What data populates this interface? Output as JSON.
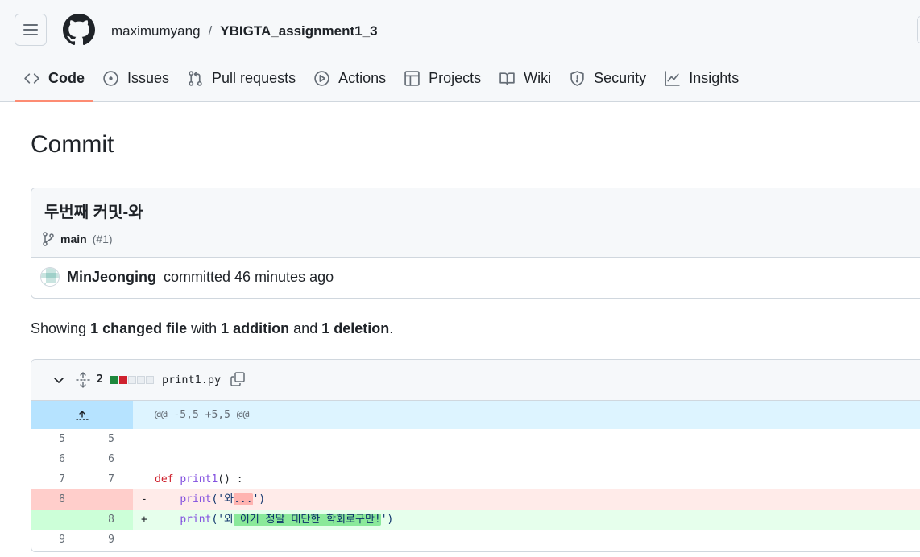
{
  "header": {
    "owner": "maximumyang",
    "separator": "/",
    "repo": "YBIGTA_assignment1_3"
  },
  "tabs": [
    {
      "label": "Code",
      "icon": "code-icon",
      "active": true
    },
    {
      "label": "Issues",
      "icon": "issue-icon"
    },
    {
      "label": "Pull requests",
      "icon": "pull-request-icon"
    },
    {
      "label": "Actions",
      "icon": "play-icon"
    },
    {
      "label": "Projects",
      "icon": "table-icon"
    },
    {
      "label": "Wiki",
      "icon": "book-icon"
    },
    {
      "label": "Security",
      "icon": "shield-icon"
    },
    {
      "label": "Insights",
      "icon": "graph-icon"
    }
  ],
  "page": {
    "title": "Commit"
  },
  "commit": {
    "message": "두번째 커밋-와",
    "branch": "main",
    "pr": "(#1)",
    "author": "MinJeonging",
    "action": "committed 46 minutes ago"
  },
  "summary": {
    "showing": "Showing",
    "files": "1 changed file",
    "with": "with",
    "additions": "1 addition",
    "and": "and",
    "deletions": "1 deletion",
    "period": "."
  },
  "diff": {
    "changes": "2",
    "filename": "print1.py",
    "hunk": "@@ -5,5 +5,5 @@",
    "lines": [
      {
        "type": "ctx",
        "old": "5",
        "new": "5",
        "sign": "",
        "code": ""
      },
      {
        "type": "ctx",
        "old": "6",
        "new": "6",
        "sign": "",
        "code": ""
      },
      {
        "type": "ctx",
        "old": "7",
        "new": "7",
        "sign": "",
        "kw": "def",
        "fn": "print1",
        "rest": "() :"
      },
      {
        "type": "del",
        "old": "8",
        "new": "",
        "sign": "-",
        "indent": "    ",
        "fn": "print",
        "pre": "('와",
        "hl": "...",
        "post": "')"
      },
      {
        "type": "add",
        "old": "",
        "new": "8",
        "sign": "+",
        "indent": "    ",
        "fn": "print",
        "pre": "('와",
        "hl": " 이거 정말 대단한 학회로구만!",
        "post": "')"
      },
      {
        "type": "ctx",
        "old": "9",
        "new": "9",
        "sign": "",
        "code": ""
      }
    ]
  },
  "colors": {
    "accent_underline": "#fd8c73",
    "add_bg": "#e6ffec",
    "del_bg": "#ffebe9",
    "hunk_bg": "#ddf4ff"
  }
}
